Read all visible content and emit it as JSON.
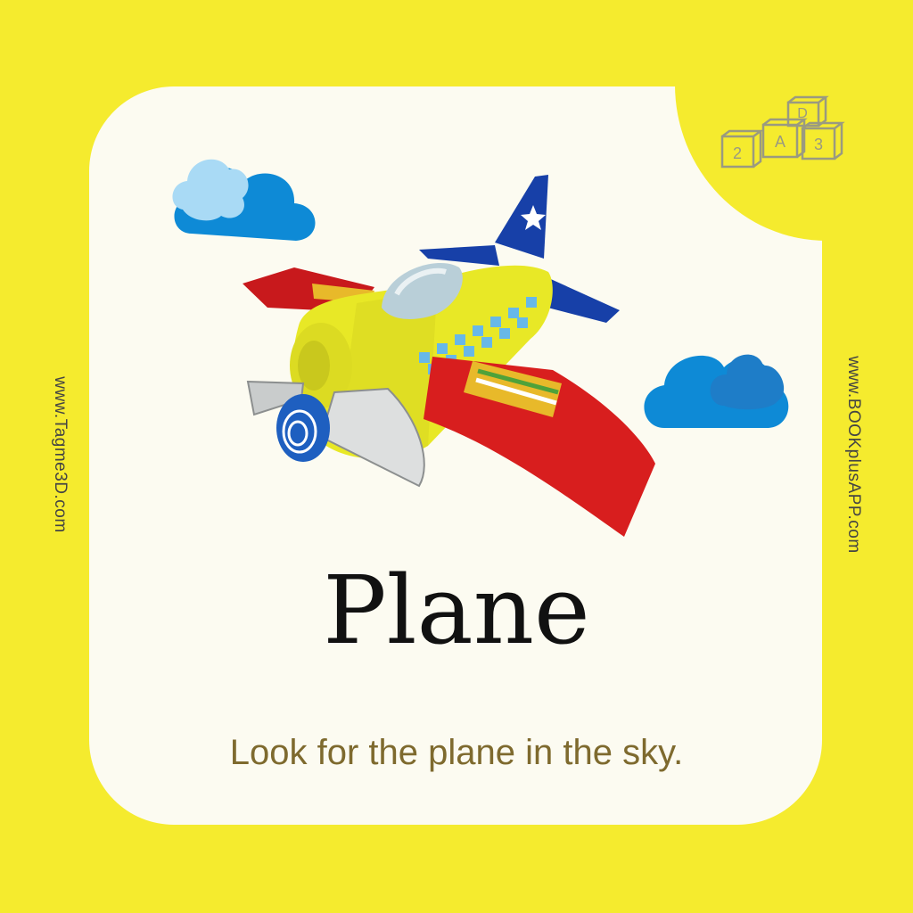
{
  "card": {
    "word": "Plane",
    "caption": "Look for the plane in the sky."
  },
  "sidebar": {
    "left_url": "www.Tagme3D.com",
    "right_url": "www.BOOKplusAPP.com"
  },
  "logo": {
    "blocks": [
      "2",
      "A",
      "D",
      "3"
    ]
  },
  "colors": {
    "background": "#F5EB2E",
    "card": "#FCFBF1",
    "caption": "#7E6A2E",
    "cloud_dark": "#0E8AD6",
    "cloud_light": "#A9DAF5",
    "wing_red": "#D81E1E",
    "body_yellow": "#E8E826",
    "tail_blue": "#1740A8"
  }
}
